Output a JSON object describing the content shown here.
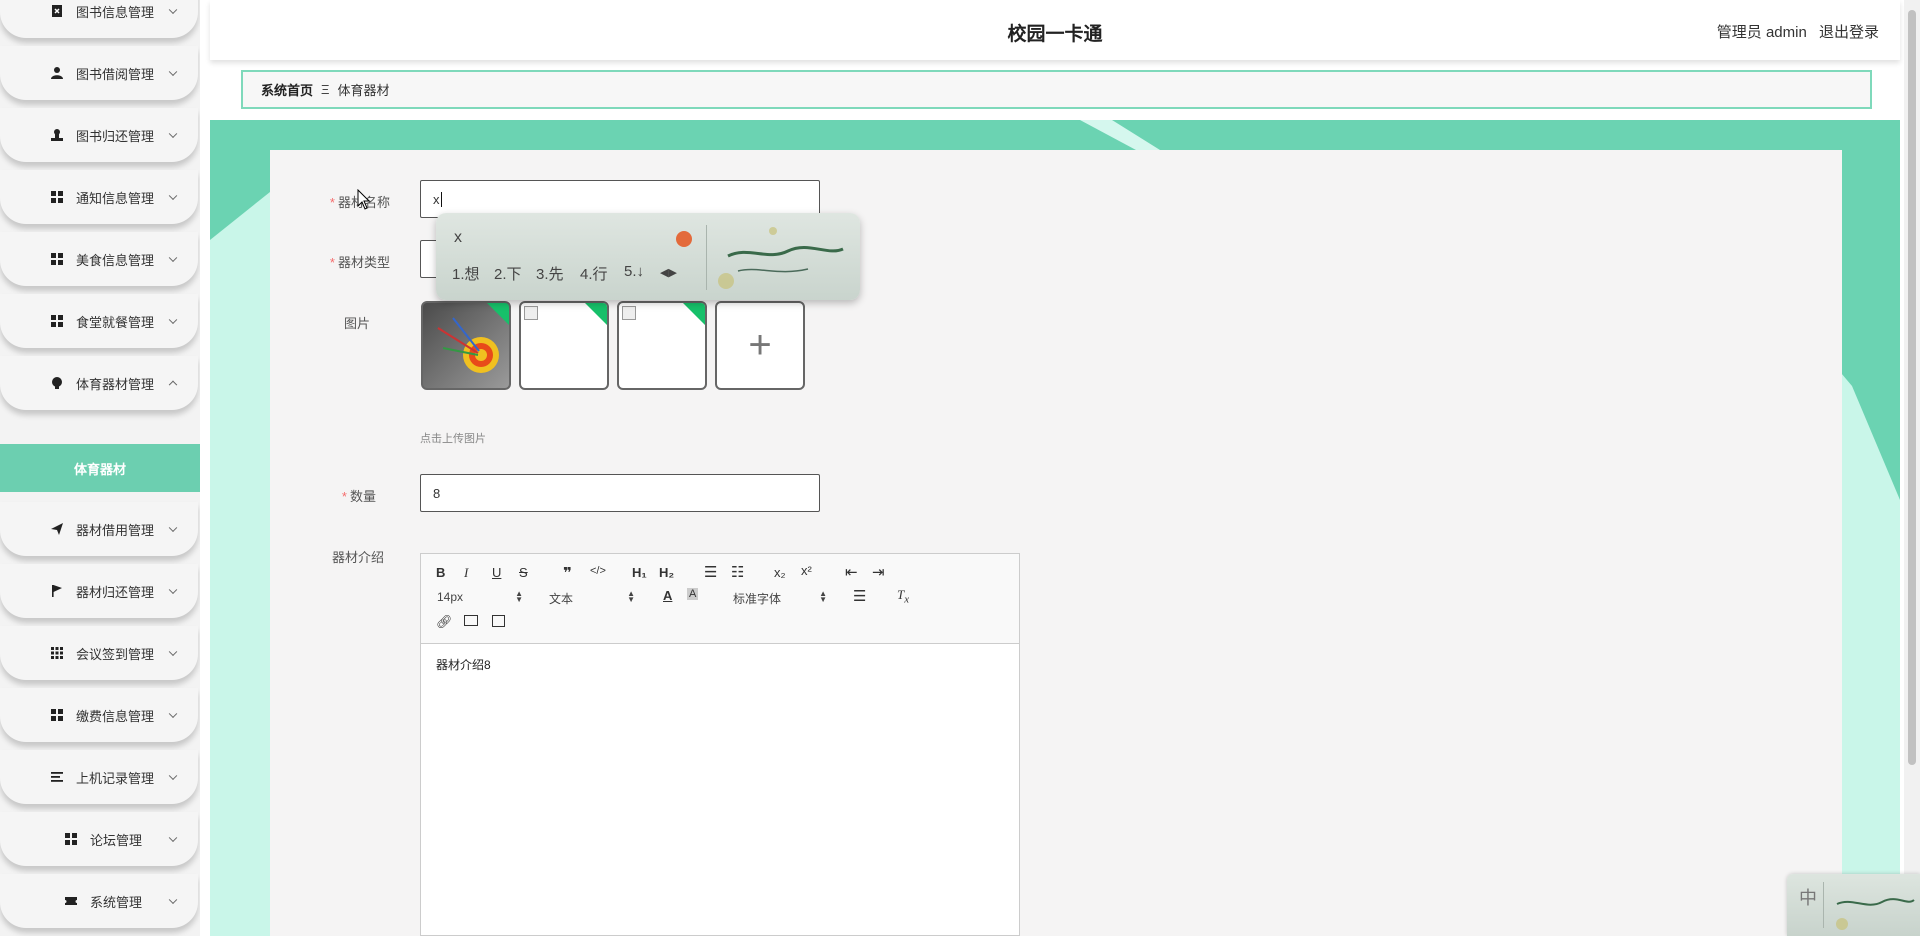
{
  "sidebar": {
    "items": [
      {
        "label": "图书信息管理",
        "icon": "book-icon"
      },
      {
        "label": "图书借阅管理",
        "icon": "user-icon"
      },
      {
        "label": "图书归还管理",
        "icon": "stamp-icon"
      },
      {
        "label": "通知信息管理",
        "icon": "grid-icon"
      },
      {
        "label": "美食信息管理",
        "icon": "grid-icon"
      },
      {
        "label": "食堂就餐管理",
        "icon": "grid-icon"
      },
      {
        "label": "体育器材管理",
        "icon": "bulb-icon"
      },
      {
        "label": "器材借用管理",
        "icon": "send-icon"
      },
      {
        "label": "器材归还管理",
        "icon": "flag-icon"
      },
      {
        "label": "会议签到管理",
        "icon": "apps-icon"
      },
      {
        "label": "缴费信息管理",
        "icon": "grid-icon"
      },
      {
        "label": "上机记录管理",
        "icon": "list-icon"
      },
      {
        "label": "论坛管理",
        "icon": "grid-icon"
      },
      {
        "label": "系统管理",
        "icon": "ticket-icon"
      }
    ],
    "active_sub": "体育器材"
  },
  "header": {
    "title": "校园一卡通",
    "user": "管理员 admin",
    "logout": "退出登录"
  },
  "breadcrumb": {
    "home": "系统首页",
    "separator": "Ξ",
    "current": "体育器材"
  },
  "form": {
    "name_label": "器材名称",
    "name_value": "x",
    "type_label": "器材类型",
    "image_label": "图片",
    "upload_hint": "点击上传图片",
    "quantity_label": "数量",
    "quantity_value": "8",
    "intro_label": "器材介绍",
    "intro_value": "器材介绍8"
  },
  "editor": {
    "font_size": "14px",
    "format": "文本",
    "font_family": "标准字体",
    "buttons": [
      "B",
      "I",
      "U",
      "S"
    ]
  },
  "ime": {
    "typed": "x",
    "candidates": [
      "1.想",
      "2.下",
      "3.先",
      "4.行",
      "5.↓"
    ],
    "mode": "中"
  },
  "colors": {
    "accent": "#6ccfb0",
    "required": "#f56c6c",
    "corner_badge": "#17c06a"
  }
}
